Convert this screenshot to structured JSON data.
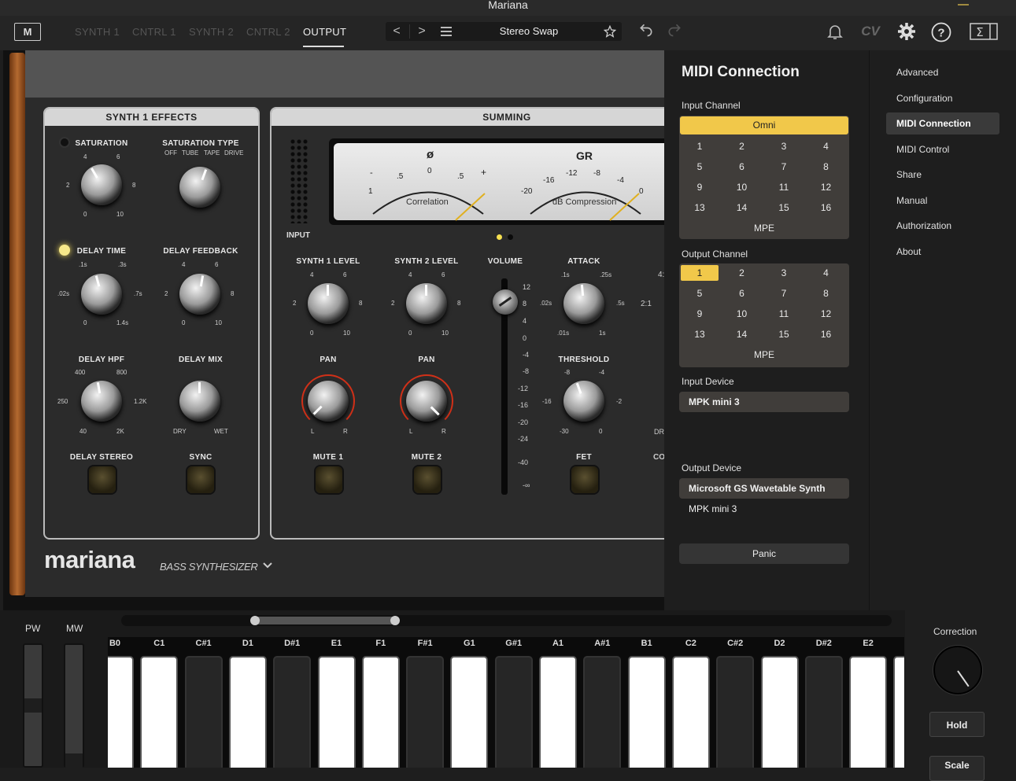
{
  "window": {
    "title": "Mariana"
  },
  "toolbar": {
    "logo": "M",
    "tabs": [
      "SYNTH 1",
      "CNTRL 1",
      "SYNTH 2",
      "CNTRL 2",
      "OUTPUT"
    ],
    "active_tab": "OUTPUT",
    "prev_label": "<",
    "next_label": ">",
    "preset_name": "Stereo Swap",
    "cv_label": "CV"
  },
  "synth_effects": {
    "header": "SYNTH 1 EFFECTS",
    "saturation": "SATURATION",
    "saturation_type": "SATURATION TYPE",
    "sat_type_options": [
      "OFF",
      "TUBE",
      "TAPE",
      "DRIVE"
    ],
    "delay_time": "DELAY TIME",
    "delay_feedback": "DELAY FEEDBACK",
    "delay_hpf": "DELAY HPF",
    "delay_mix": "DELAY MIX",
    "delay_stereo": "DELAY STEREO",
    "sync": "SYNC",
    "sat_ticks": [
      "4",
      "6",
      "2",
      "8",
      "0",
      "10"
    ],
    "time_ticks": [
      ".1s",
      ".3s",
      ".02s",
      ".7s",
      "0",
      "1.4s"
    ],
    "fb_ticks": [
      "4",
      "6",
      "2",
      "8",
      "0",
      "10"
    ],
    "hpf_ticks": [
      "400",
      "800",
      "250",
      "1.2K",
      "40",
      "2K"
    ],
    "mix_ticks": [
      "DRY",
      "WET"
    ]
  },
  "summing": {
    "header": "SUMMING",
    "input": "INPUT",
    "phase": "ø",
    "gr": "GR",
    "correlation": "Correlation",
    "compression": "dB Compression",
    "corr_ticks": [
      "-",
      ".5",
      "0",
      ".5",
      "+",
      "1"
    ],
    "comp_ticks": [
      "-12",
      "-8",
      "-16",
      "-4",
      "-20",
      "0"
    ],
    "synth1_level": "SYNTH 1 LEVEL",
    "synth2_level": "SYNTH 2 LEVEL",
    "volume": "VOLUME",
    "attack": "ATTACK",
    "pan1": "PAN",
    "pan2": "PAN",
    "threshold": "THRESHOLD",
    "mute1": "MUTE 1",
    "mute2": "MUTE 2",
    "fet": "FET",
    "partial_right_1": "4:",
    "partial_right_2": "2:1",
    "partial_right_3": "DR",
    "partial_right_4": "CO",
    "attack_ticks": [
      ".1s",
      ".25s",
      ".02s",
      ".5s",
      ".01s",
      "1s"
    ],
    "threshold_ticks": [
      "-8",
      "-4",
      "-16",
      "-2",
      "-30",
      "0"
    ],
    "level_ticks": [
      "4",
      "6",
      "2",
      "8",
      "0",
      "10"
    ],
    "pan_ticks": [
      "L",
      "R"
    ],
    "vol_scale": [
      "12",
      "8",
      "4",
      "0",
      "-4",
      "-8",
      "-12",
      "-16",
      "-20",
      "-24",
      "-40",
      "-∞"
    ]
  },
  "brand": {
    "name": "mariana",
    "subtitle": "BASS SYNTHESIZER"
  },
  "midi": {
    "title": "MIDI Connection",
    "input_channel_label": "Input Channel",
    "omni": "Omni",
    "channels": [
      "1",
      "2",
      "3",
      "4",
      "5",
      "6",
      "7",
      "8",
      "9",
      "10",
      "11",
      "12",
      "13",
      "14",
      "15",
      "16"
    ],
    "mpe": "MPE",
    "output_channel_label": "Output Channel",
    "output_selected": "1",
    "input_device_label": "Input Device",
    "input_device": "MPK mini 3",
    "output_device_label": "Output Device",
    "output_devices": [
      "Microsoft GS Wavetable Synth",
      "MPK mini 3"
    ],
    "panic": "Panic"
  },
  "side_menu": {
    "items": [
      "Advanced",
      "Configuration",
      "MIDI Connection",
      "MIDI Control",
      "Share",
      "Manual",
      "Authorization",
      "About"
    ],
    "active": "MIDI Connection"
  },
  "keyboard": {
    "pw": "PW",
    "mw": "MW",
    "keys": [
      "B0",
      "C1",
      "C#1",
      "D1",
      "D#1",
      "E1",
      "F1",
      "F#1",
      "G1",
      "G#1",
      "A1",
      "A#1",
      "B1",
      "C2",
      "C#2",
      "D2",
      "D#2",
      "E2"
    ],
    "correction": "Correction",
    "hold": "Hold",
    "scale": "Scale"
  }
}
